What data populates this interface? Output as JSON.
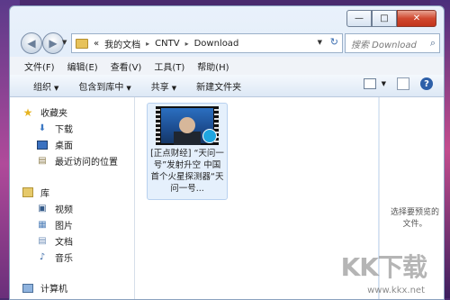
{
  "window": {
    "minimize_icon": "—",
    "maximize_icon": "□",
    "close_icon": "✕"
  },
  "nav": {
    "address": {
      "prefix": "«",
      "segments": [
        "我的文档",
        "CNTV",
        "Download"
      ]
    },
    "search_placeholder": "搜索 Download"
  },
  "menu": [
    "文件(F)",
    "编辑(E)",
    "查看(V)",
    "工具(T)",
    "帮助(H)"
  ],
  "toolbar": {
    "organize": "组织",
    "include": "包含到库中",
    "share": "共享",
    "new_folder": "新建文件夹",
    "help": "?"
  },
  "sidebar": {
    "favorites": {
      "label": "收藏夹",
      "items": [
        "下载",
        "桌面",
        "最近访问的位置"
      ]
    },
    "libraries": {
      "label": "库",
      "items": [
        "视频",
        "图片",
        "文档",
        "音乐"
      ]
    },
    "computer": "计算机"
  },
  "files": [
    {
      "name": "[正点财经] “天问一号”发射升空 中国首个火星探测器“天问一号..."
    }
  ],
  "preview": {
    "message": "选择要预览的文件。"
  },
  "watermark": {
    "text": "KK下载",
    "url": "www.kkx.net"
  },
  "colors": {
    "accent": "#2d5fa8",
    "close": "#c2341b",
    "selection": "#e5f0fc"
  }
}
